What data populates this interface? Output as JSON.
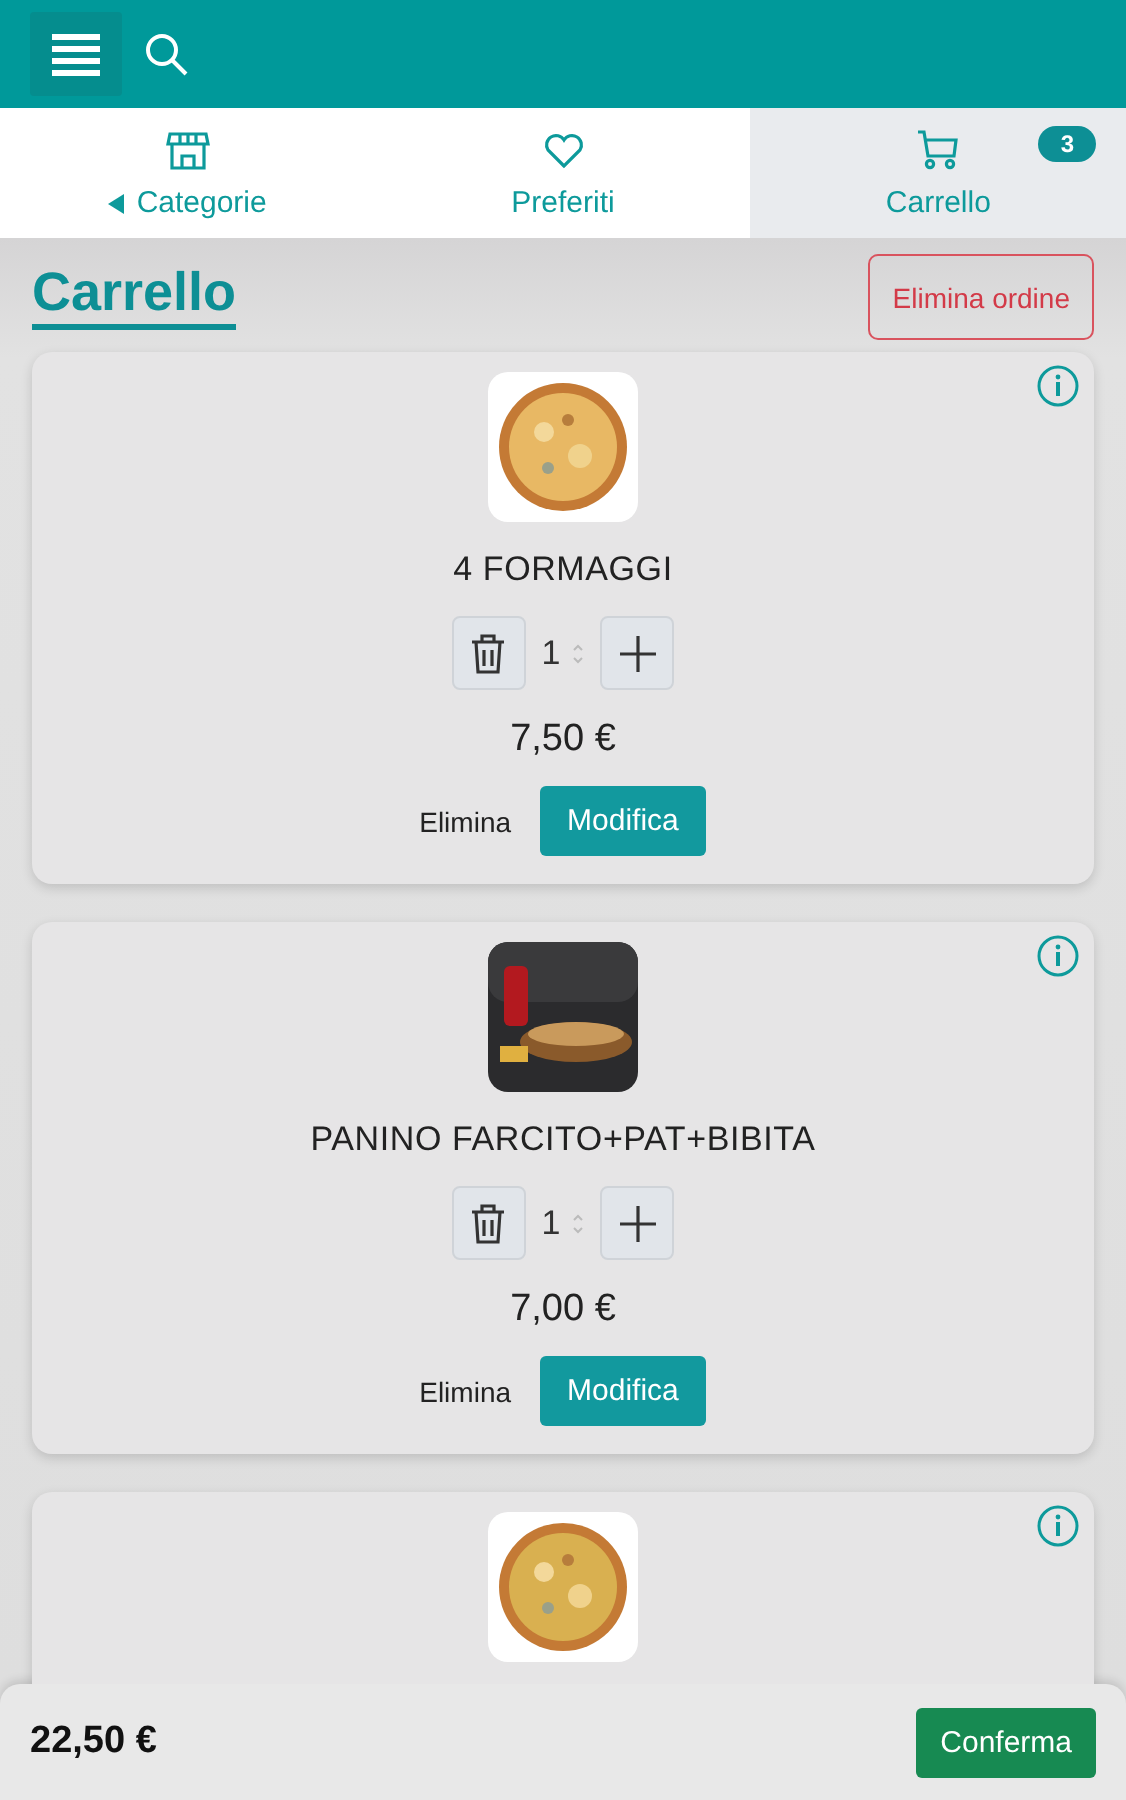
{
  "tabs": [
    {
      "kind": "store",
      "label": "Categorie",
      "back": true,
      "selected": false
    },
    {
      "kind": "heart",
      "label": "Preferiti",
      "back": false,
      "selected": false
    },
    {
      "kind": "cart",
      "label": "Carrello",
      "back": false,
      "selected": true,
      "badge": "3"
    }
  ],
  "title": "Carrello",
  "clear_button": "Elimina ordine",
  "items": [
    {
      "kind": "full",
      "name": "4 FORMAGGI",
      "quantity": "1",
      "price": "7,50 €",
      "remove": "Elimina",
      "edit": "Modifica"
    },
    {
      "kind": "full",
      "name": "PANINO FARCITO+PAT+BIBITA",
      "quantity": "1",
      "price": "7,00 €",
      "remove": "Elimina",
      "edit": "Modifica"
    },
    {
      "kind": "cut"
    }
  ],
  "total": "22,50 €",
  "confirm_button": "Conferma"
}
